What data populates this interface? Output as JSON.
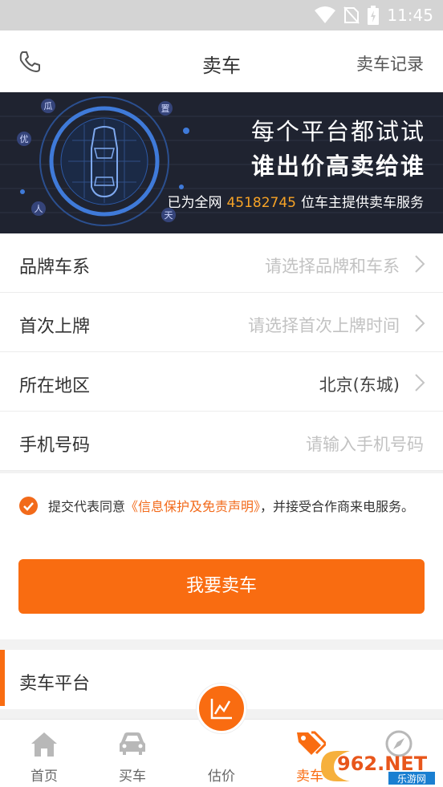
{
  "status_bar": {
    "time": "11:45",
    "icons": [
      "wifi-icon",
      "no-sim-icon",
      "battery-icon"
    ]
  },
  "header": {
    "title": "卖车",
    "record_link": "卖车记录",
    "left_icon": "phone-icon"
  },
  "banner": {
    "line1": "每个平台都试试",
    "line2": "谁出价高卖给谁",
    "line3_prefix": "已为全网",
    "line3_number": "45182745",
    "line3_suffix": "位车主提供卖车服务",
    "ring_chars": [
      "瓜",
      "置",
      "优",
      "人",
      "天"
    ],
    "accent_color": "#f7a326"
  },
  "form": {
    "rows": [
      {
        "label": "品牌车系",
        "value": "请选择品牌和车系",
        "placeholder": true,
        "arrow": true
      },
      {
        "label": "首次上牌",
        "value": "请选择首次上牌时间",
        "placeholder": true,
        "arrow": true
      },
      {
        "label": "所在地区",
        "value": "北京(东城)",
        "placeholder": false,
        "arrow": true
      },
      {
        "label": "手机号码",
        "value": "请输入手机号码",
        "placeholder": true,
        "arrow": false
      }
    ]
  },
  "agreement": {
    "checked": true,
    "text_before": "提交代表同意",
    "link": "《信息保护及免责声明》",
    "text_after": "，并接受合作商来电服务。"
  },
  "submit_button": "我要卖车",
  "platform_section": {
    "label": "卖车平台"
  },
  "tabbar": {
    "tabs": [
      {
        "label": "首页",
        "icon": "home-icon"
      },
      {
        "label": "买车",
        "icon": "car-icon"
      },
      {
        "label": "估价",
        "icon": "chart-line-icon"
      },
      {
        "label": "卖车",
        "icon": "tags-icon",
        "active": true
      },
      {
        "label": "",
        "icon": "compass-icon"
      }
    ]
  },
  "watermark": {
    "text": "962.NET",
    "subtext": "乐游网"
  },
  "colors": {
    "accent": "#f96c11",
    "banner_bg": "#1f2330",
    "link": "#f26a1a"
  }
}
